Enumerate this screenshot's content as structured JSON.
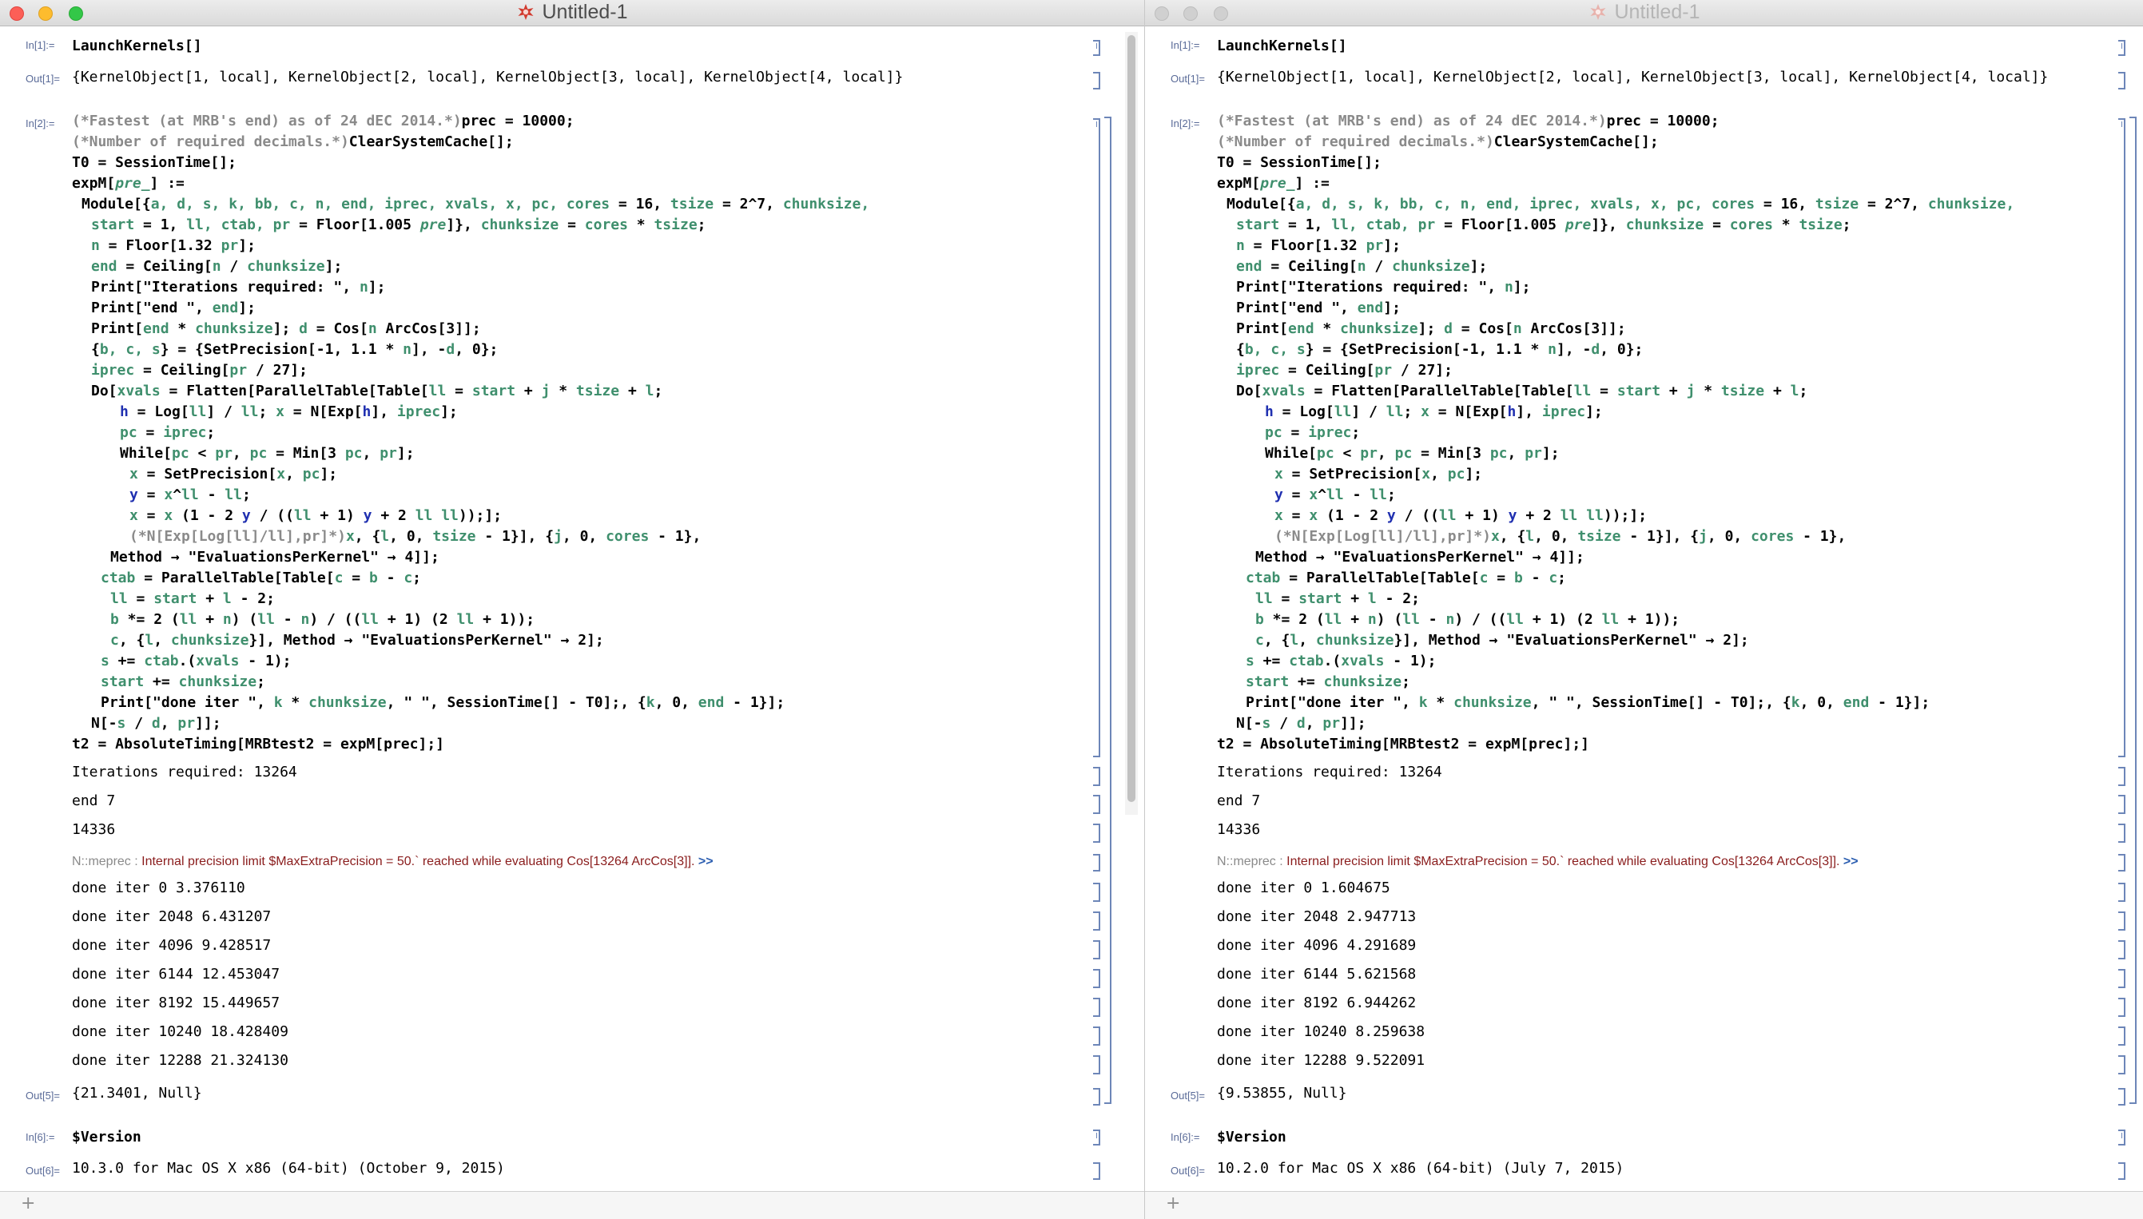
{
  "left": {
    "title": "Untitled-1",
    "in1": "In[1]:=",
    "out1": "Out[1]=",
    "in2": "In[2]:=",
    "out5": "Out[5]=",
    "in6": "In[6]:=",
    "out6": "Out[6]=",
    "launch": "LaunchKernels[]",
    "kernels": "{KernelObject[1, local], KernelObject[2, local], KernelObject[3, local], KernelObject[4, local]}",
    "iterations": "Iterations required: 13264",
    "end": "end 7",
    "n": "14336",
    "msg_tag": "N::meprec : ",
    "msg_text": "Internal precision limit $MaxExtraPrecision = 50.` reached while evaluating Cos[13264 ArcCos[3]].",
    "msg_more": " >>",
    "iters": [
      "done iter 0 3.376110",
      "done iter 2048 6.431207",
      "done iter 4096 9.428517",
      "done iter 6144 12.453047",
      "done iter 8192 15.449657",
      "done iter 10240 18.428409",
      "done iter 12288 21.324130"
    ],
    "result": "{21.3401, Null}",
    "version_cmd": "$Version",
    "version": "10.3.0 for Mac OS X x86 (64-bit) (October 9, 2015)"
  },
  "right": {
    "title": "Untitled-1",
    "in1": "In[1]:=",
    "out1": "Out[1]=",
    "in2": "In[2]:=",
    "out5": "Out[5]=",
    "in6": "In[6]:=",
    "out6": "Out[6]=",
    "launch": "LaunchKernels[]",
    "kernels": "{KernelObject[1, local], KernelObject[2, local], KernelObject[3, local], KernelObject[4, local]}",
    "iterations": "Iterations required: 13264",
    "end": "end 7",
    "n": "14336",
    "msg_tag": "N::meprec : ",
    "msg_text": "Internal precision limit $MaxExtraPrecision = 50.` reached while evaluating Cos[13264 ArcCos[3]].",
    "msg_more": " >>",
    "iters": [
      "done iter 0 1.604675",
      "done iter 2048 2.947713",
      "done iter 4096 4.291689",
      "done iter 6144 5.621568",
      "done iter 8192 6.944262",
      "done iter 10240 8.259638",
      "done iter 12288 9.522091"
    ],
    "result": "{9.53855, Null}",
    "version_cmd": "$Version",
    "version": "10.2.0 for Mac OS X x86 (64-bit) (July 7, 2015)"
  },
  "code_lines": [
    {
      "indent": 0,
      "segs": [
        {
          "t": "(*Fastest (at MRB's end) as of 24 dEC 2014.*)",
          "c": "cm"
        },
        {
          "t": "prec = 10000;"
        }
      ]
    },
    {
      "indent": 0,
      "segs": [
        {
          "t": "(*Number of required decimals.*)",
          "c": "cm"
        },
        {
          "t": "ClearSystemCache[];"
        }
      ]
    },
    {
      "indent": 0,
      "segs": [
        {
          "t": "T0 = SessionTime[];"
        }
      ]
    },
    {
      "indent": 0,
      "segs": [
        {
          "t": "expM["
        },
        {
          "t": "pre_",
          "c": "g it"
        },
        {
          "t": "] :="
        }
      ]
    },
    {
      "indent": 1,
      "segs": [
        {
          "t": "Module[{"
        },
        {
          "t": "a, d, s, k, bb, c, n, end, iprec, xvals, x, pc, cores",
          "c": "g"
        },
        {
          "t": " = 16, "
        },
        {
          "t": "tsize",
          "c": "g"
        },
        {
          "t": " = 2^7, "
        },
        {
          "t": "chunksize,",
          "c": "g"
        }
      ]
    },
    {
      "indent": 2,
      "segs": [
        {
          "t": "start",
          "c": "g"
        },
        {
          "t": " = 1, "
        },
        {
          "t": "ll, ctab, pr",
          "c": "g"
        },
        {
          "t": " = Floor[1.005 "
        },
        {
          "t": "pre",
          "c": "g it"
        },
        {
          "t": "]}, "
        },
        {
          "t": "chunksize",
          "c": "g"
        },
        {
          "t": " = "
        },
        {
          "t": "cores",
          "c": "g"
        },
        {
          "t": " * "
        },
        {
          "t": "tsize",
          "c": "g"
        },
        {
          "t": ";"
        }
      ]
    },
    {
      "indent": 2,
      "segs": [
        {
          "t": "n",
          "c": "g"
        },
        {
          "t": " = Floor[1.32 "
        },
        {
          "t": "pr",
          "c": "g"
        },
        {
          "t": "];"
        }
      ]
    },
    {
      "indent": 2,
      "segs": [
        {
          "t": "end",
          "c": "g"
        },
        {
          "t": " = Ceiling["
        },
        {
          "t": "n",
          "c": "g"
        },
        {
          "t": " / "
        },
        {
          "t": "chunksize",
          "c": "g"
        },
        {
          "t": "];"
        }
      ]
    },
    {
      "indent": 2,
      "segs": [
        {
          "t": "Print[\"Iterations required: \", "
        },
        {
          "t": "n",
          "c": "g"
        },
        {
          "t": "];"
        }
      ]
    },
    {
      "indent": 2,
      "segs": [
        {
          "t": "Print[\"end \", "
        },
        {
          "t": "end",
          "c": "g"
        },
        {
          "t": "];"
        }
      ]
    },
    {
      "indent": 2,
      "segs": [
        {
          "t": "Print["
        },
        {
          "t": "end",
          "c": "g"
        },
        {
          "t": " * "
        },
        {
          "t": "chunksize",
          "c": "g"
        },
        {
          "t": "]; "
        },
        {
          "t": "d",
          "c": "g"
        },
        {
          "t": " = Cos["
        },
        {
          "t": "n",
          "c": "g"
        },
        {
          "t": " ArcCos[3]];"
        }
      ]
    },
    {
      "indent": 2,
      "segs": [
        {
          "t": "{"
        },
        {
          "t": "b, c, s",
          "c": "g"
        },
        {
          "t": "} = {SetPrecision[-1, 1.1 * "
        },
        {
          "t": "n",
          "c": "g"
        },
        {
          "t": "], -"
        },
        {
          "t": "d",
          "c": "g"
        },
        {
          "t": ", 0};"
        }
      ]
    },
    {
      "indent": 2,
      "segs": [
        {
          "t": "iprec",
          "c": "g"
        },
        {
          "t": " = Ceiling["
        },
        {
          "t": "pr",
          "c": "g"
        },
        {
          "t": " / 27];"
        }
      ]
    },
    {
      "indent": 2,
      "segs": [
        {
          "t": "Do["
        },
        {
          "t": "xvals",
          "c": "g"
        },
        {
          "t": " = Flatten[ParallelTable[Table["
        },
        {
          "t": "ll",
          "c": "g"
        },
        {
          "t": " = "
        },
        {
          "t": "start",
          "c": "g"
        },
        {
          "t": " + "
        },
        {
          "t": "j",
          "c": "g"
        },
        {
          "t": " * "
        },
        {
          "t": "tsize",
          "c": "g"
        },
        {
          "t": " + "
        },
        {
          "t": "l",
          "c": "g"
        },
        {
          "t": ";"
        }
      ]
    },
    {
      "indent": 5,
      "segs": [
        {
          "t": "h",
          "c": "b"
        },
        {
          "t": " = Log["
        },
        {
          "t": "ll",
          "c": "g"
        },
        {
          "t": "] / "
        },
        {
          "t": "ll",
          "c": "g"
        },
        {
          "t": "; "
        },
        {
          "t": "x",
          "c": "g"
        },
        {
          "t": " = N[Exp["
        },
        {
          "t": "h",
          "c": "b"
        },
        {
          "t": "], "
        },
        {
          "t": "iprec",
          "c": "g"
        },
        {
          "t": "];"
        }
      ]
    },
    {
      "indent": 5,
      "segs": [
        {
          "t": "pc",
          "c": "g"
        },
        {
          "t": " = "
        },
        {
          "t": "iprec",
          "c": "g"
        },
        {
          "t": ";"
        }
      ]
    },
    {
      "indent": 5,
      "segs": [
        {
          "t": "While["
        },
        {
          "t": "pc",
          "c": "g"
        },
        {
          "t": " < "
        },
        {
          "t": "pr",
          "c": "g"
        },
        {
          "t": ", "
        },
        {
          "t": "pc",
          "c": "g"
        },
        {
          "t": " = Min[3 "
        },
        {
          "t": "pc",
          "c": "g"
        },
        {
          "t": ", "
        },
        {
          "t": "pr",
          "c": "g"
        },
        {
          "t": "];"
        }
      ]
    },
    {
      "indent": 6,
      "segs": [
        {
          "t": "x",
          "c": "g"
        },
        {
          "t": " = SetPrecision["
        },
        {
          "t": "x",
          "c": "g"
        },
        {
          "t": ", "
        },
        {
          "t": "pc",
          "c": "g"
        },
        {
          "t": "];"
        }
      ]
    },
    {
      "indent": 6,
      "segs": [
        {
          "t": "y",
          "c": "b"
        },
        {
          "t": " = "
        },
        {
          "t": "x",
          "c": "g"
        },
        {
          "t": "^"
        },
        {
          "t": "ll",
          "c": "g"
        },
        {
          "t": " - "
        },
        {
          "t": "ll",
          "c": "g"
        },
        {
          "t": ";"
        }
      ]
    },
    {
      "indent": 6,
      "segs": [
        {
          "t": "x",
          "c": "g"
        },
        {
          "t": " = "
        },
        {
          "t": "x",
          "c": "g"
        },
        {
          "t": " (1 - 2 "
        },
        {
          "t": "y",
          "c": "b"
        },
        {
          "t": " / (("
        },
        {
          "t": "ll",
          "c": "g"
        },
        {
          "t": " + 1) "
        },
        {
          "t": "y",
          "c": "b"
        },
        {
          "t": " + 2 "
        },
        {
          "t": "ll ll",
          "c": "g"
        },
        {
          "t": "));];"
        }
      ]
    },
    {
      "indent": 6,
      "segs": [
        {
          "t": "(*N[Exp[Log[ll]/ll],pr]*)",
          "c": "cm"
        },
        {
          "t": "x",
          "c": "g"
        },
        {
          "t": ", {"
        },
        {
          "t": "l",
          "c": "g"
        },
        {
          "t": ", 0, "
        },
        {
          "t": "tsize",
          "c": "g"
        },
        {
          "t": " - 1}], {"
        },
        {
          "t": "j",
          "c": "g"
        },
        {
          "t": ", 0, "
        },
        {
          "t": "cores",
          "c": "g"
        },
        {
          "t": " - 1},"
        }
      ]
    },
    {
      "indent": 4,
      "segs": [
        {
          "t": "Method → \"EvaluationsPerKernel\" → 4]];"
        }
      ]
    },
    {
      "indent": 3,
      "segs": [
        {
          "t": "ctab",
          "c": "g"
        },
        {
          "t": " = ParallelTable[Table["
        },
        {
          "t": "c",
          "c": "g"
        },
        {
          "t": " = "
        },
        {
          "t": "b",
          "c": "g"
        },
        {
          "t": " - "
        },
        {
          "t": "c",
          "c": "g"
        },
        {
          "t": ";"
        }
      ]
    },
    {
      "indent": 4,
      "segs": [
        {
          "t": "ll",
          "c": "g"
        },
        {
          "t": " = "
        },
        {
          "t": "start",
          "c": "g"
        },
        {
          "t": " + "
        },
        {
          "t": "l",
          "c": "g"
        },
        {
          "t": " - 2;"
        }
      ]
    },
    {
      "indent": 4,
      "segs": [
        {
          "t": "b",
          "c": "g"
        },
        {
          "t": " *= 2 ("
        },
        {
          "t": "ll",
          "c": "g"
        },
        {
          "t": " + "
        },
        {
          "t": "n",
          "c": "g"
        },
        {
          "t": ") ("
        },
        {
          "t": "ll",
          "c": "g"
        },
        {
          "t": " - "
        },
        {
          "t": "n",
          "c": "g"
        },
        {
          "t": ") / (("
        },
        {
          "t": "ll",
          "c": "g"
        },
        {
          "t": " + 1) (2 "
        },
        {
          "t": "ll",
          "c": "g"
        },
        {
          "t": " + 1));"
        }
      ]
    },
    {
      "indent": 4,
      "segs": [
        {
          "t": "c",
          "c": "g"
        },
        {
          "t": ", {"
        },
        {
          "t": "l",
          "c": "g"
        },
        {
          "t": ", "
        },
        {
          "t": "chunksize",
          "c": "g"
        },
        {
          "t": "}], Method → \"EvaluationsPerKernel\" → 2];"
        }
      ]
    },
    {
      "indent": 3,
      "segs": [
        {
          "t": "s",
          "c": "g"
        },
        {
          "t": " += "
        },
        {
          "t": "ctab",
          "c": "g"
        },
        {
          "t": ".("
        },
        {
          "t": "xvals",
          "c": "g"
        },
        {
          "t": " - 1);"
        }
      ]
    },
    {
      "indent": 3,
      "segs": [
        {
          "t": "start",
          "c": "g"
        },
        {
          "t": " += "
        },
        {
          "t": "chunksize",
          "c": "g"
        },
        {
          "t": ";"
        }
      ]
    },
    {
      "indent": 3,
      "segs": [
        {
          "t": "Print[\"done iter \", "
        },
        {
          "t": "k",
          "c": "g"
        },
        {
          "t": " * "
        },
        {
          "t": "chunksize",
          "c": "g"
        },
        {
          "t": ", \" \", SessionTime[] - T0];, {"
        },
        {
          "t": "k",
          "c": "g"
        },
        {
          "t": ", 0, "
        },
        {
          "t": "end",
          "c": "g"
        },
        {
          "t": " - 1}];"
        }
      ]
    },
    {
      "indent": 2,
      "segs": [
        {
          "t": "N[-"
        },
        {
          "t": "s",
          "c": "g"
        },
        {
          "t": " / "
        },
        {
          "t": "d",
          "c": "g"
        },
        {
          "t": ", "
        },
        {
          "t": "pr",
          "c": "g"
        },
        {
          "t": "]];"
        }
      ]
    },
    {
      "indent": 0,
      "segs": [
        {
          "t": "t2 = AbsoluteTiming[MRBtest2 = expM[prec];]"
        }
      ]
    }
  ],
  "colors": {
    "traffic_red": "#fc5f57",
    "traffic_yellow": "#fdbc2e",
    "traffic_green": "#33c748",
    "traffic_inactive": "#d0d0d0",
    "bracket": "#6d86b8",
    "comment": "#8a8a8a",
    "local_var": "#3f8f6d",
    "blue_var": "#2030b0",
    "message": "#8a1c1c"
  }
}
